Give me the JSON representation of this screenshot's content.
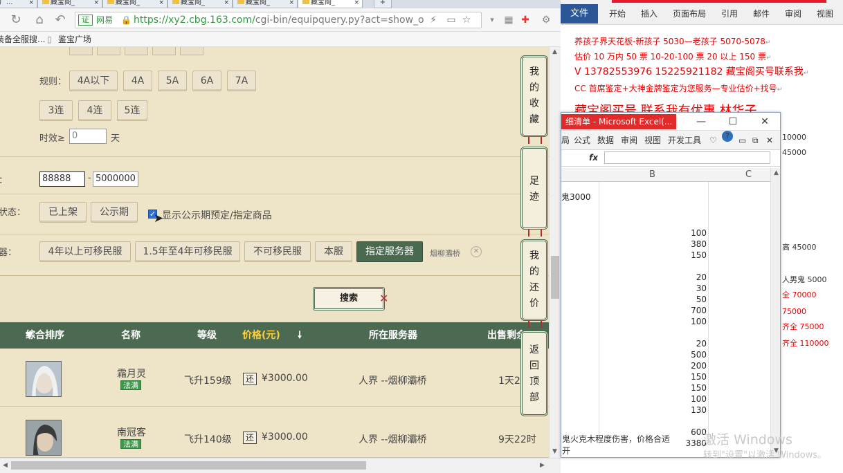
{
  "browser": {
    "tabs": [
      {
        "label": "鉴宝广..."
      },
      {
        "label": "藏宝阁_"
      },
      {
        "label": "藏宝阁_"
      },
      {
        "label": "藏宝阁_"
      },
      {
        "label": "藏宝阁_"
      },
      {
        "label": "藏宝阁_"
      }
    ],
    "address": {
      "badge": "证",
      "site_name": "网易",
      "url_main": "https://xy2.cbg.163.com/",
      "url_rest": "cgi-bin/equipquery.py?act=show_ove"
    },
    "bookmarks": [
      "装备全服搜...",
      "鉴宝广场"
    ]
  },
  "page": {
    "rules_label": "规则：",
    "rules_buttons": [
      "4A以下",
      "4A",
      "5A",
      "6A",
      "7A"
    ],
    "chain_buttons": [
      "3连",
      "4连",
      "5连"
    ],
    "validity_label": "时效≥",
    "validity_value": "0",
    "validity_unit": "天",
    "price_label": "：",
    "price_min": "88888",
    "price_dash": "-",
    "price_max": "5000000",
    "status_label": "状态：",
    "status_buttons": [
      "已上架",
      "公示期"
    ],
    "show_preorder_label": "显示公示期预定/指定商品",
    "server_label": "器：",
    "server_buttons": [
      "4年以上可移民服",
      "1.5年至4年可移民服",
      "不可移民服",
      "本服",
      "指定服务器"
    ],
    "server_selected": "烟柳灞桥",
    "search_label": "搜索",
    "side_nav": [
      "我的收藏",
      "足迹",
      "我的还价",
      "返回顶部"
    ]
  },
  "results": {
    "headers": {
      "sort": "综合排序",
      "name": "名称",
      "level": "等级",
      "price": "价格(元)",
      "server": "所在服务器",
      "time": "出售剩余"
    },
    "rows": [
      {
        "name": "霜月灵",
        "tag": "法满",
        "level": "飞升159级",
        "haggle": "还",
        "price": "¥3000.00",
        "server": "人界 --烟柳灞桥",
        "time": "1天2"
      },
      {
        "name": "南冠客",
        "tag": "法满",
        "level": "飞升140级",
        "haggle": "还",
        "price": "¥3000.00",
        "server": "人界 --烟柳灞桥",
        "time": "9天22时"
      }
    ]
  },
  "word": {
    "ribbon_tabs": [
      "文件",
      "开始",
      "插入",
      "页面布局",
      "引用",
      "邮件",
      "审阅",
      "视图"
    ],
    "lines": [
      "养孩子界天花板-新孩子 5030—老孩子 5070-5078",
      "估价 10 万内 50 票    10-20-100 票        20 以上 150 票",
      "V 13782553976    15225921182   藏宝阁买号联系我",
      "CC 首席鉴定+大神金牌鉴定为您服务—专业估价+找号",
      "藏宝阁买号  联系我有优惠  林华子"
    ],
    "right_fragments": [
      "10000",
      "45000",
      "高 45000",
      "人男鬼 5000",
      "全 70000",
      "75000",
      "齐全 75000",
      "齐全 110000"
    ],
    "bottom_text": [
      "鬼火克木程度伤害，价格合适",
      "开"
    ],
    "watermark": "激活 Windows",
    "watermark_sub": "转到\"设置\"以激活 Windows。"
  },
  "excel": {
    "title": "细清单 - Microsoft Excel(...",
    "menu": [
      "局",
      "公式",
      "数据",
      "审阅",
      "视图",
      "开发工具"
    ],
    "fx": "fx",
    "columns": [
      "B",
      "C"
    ],
    "cell_a": "鬼3000",
    "values": [
      "100",
      "380",
      "150",
      "",
      "20",
      "30",
      "50",
      "700",
      "100",
      "",
      "20",
      "500",
      "200",
      "150",
      "150",
      "100",
      "130",
      "",
      "600",
      "3380"
    ]
  }
}
